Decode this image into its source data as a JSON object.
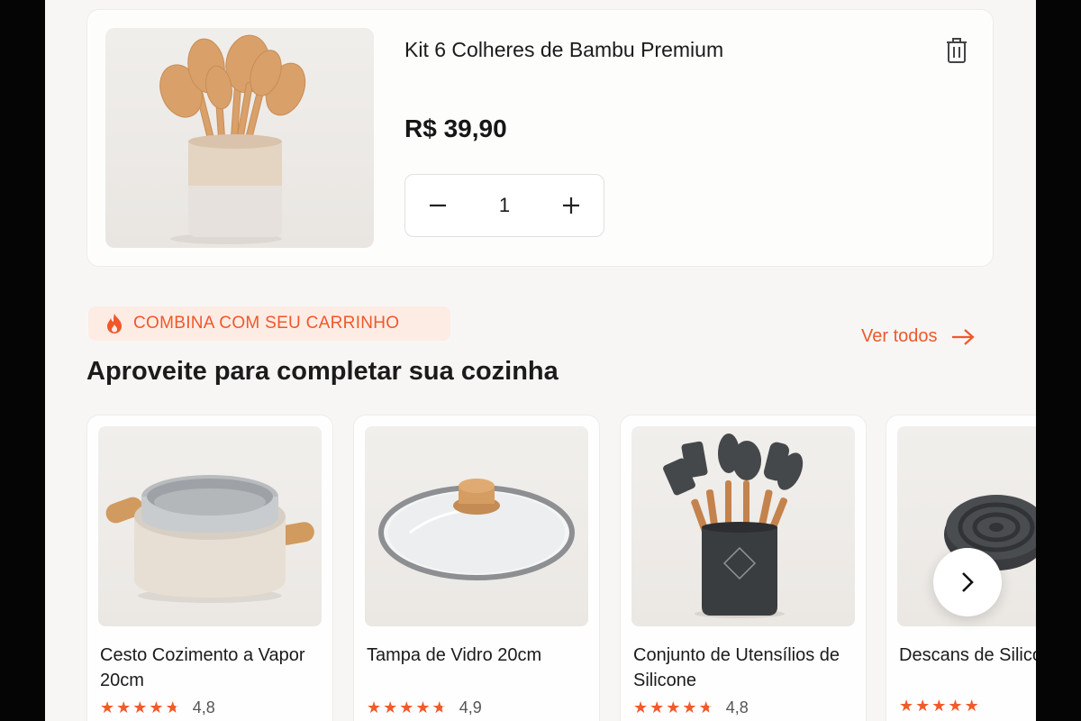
{
  "cart_item": {
    "title": "Kit 6 Colheres de Bambu Premium",
    "price": "R$ 39,90",
    "quantity": "1",
    "image_icon": "bamboo-spoons-image",
    "delete_icon": "trash-icon"
  },
  "section": {
    "badge_icon": "flame-icon",
    "badge_text": "COMBINA COM SEU CARRINHO",
    "see_all_label": "Ver todos",
    "title": "Aproveite para completar sua cozinha"
  },
  "products": [
    {
      "title": "Cesto Cozimento a Vapor 20cm",
      "rating": "4,8",
      "stars": 4.8
    },
    {
      "title": "Tampa de Vidro 20cm",
      "rating": "4,9",
      "stars": 4.9
    },
    {
      "title": "Conjunto de Utensílios de Silicone",
      "rating": "4,8",
      "stars": 4.8
    },
    {
      "title": "Descans de Silico",
      "stars": 5
    }
  ],
  "colors": {
    "accent": "#f0582a",
    "background": "#f7f6f4",
    "card": "#fefefe",
    "text": "#1b1b1b"
  }
}
